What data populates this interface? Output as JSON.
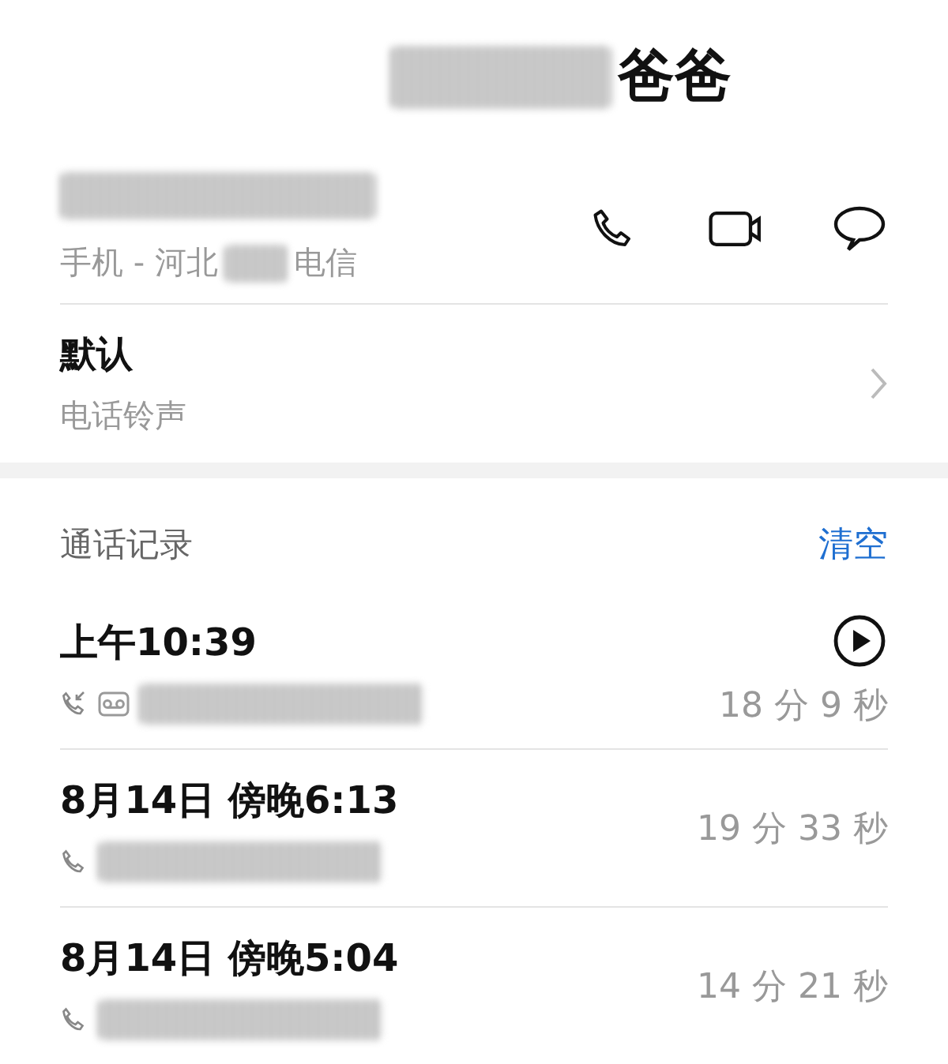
{
  "contact": {
    "name": "爸爸",
    "number_type": "手机 - 河北",
    "carrier": "电信"
  },
  "ringtone": {
    "value": "默认",
    "label": "电话铃声"
  },
  "call_log": {
    "title": "通话记录",
    "clear": "清空",
    "entries": [
      {
        "time": "上午10:39",
        "duration": "18 分 9 秒",
        "voicemail": true
      },
      {
        "time": "8月14日 傍晚6:13",
        "duration": "19 分 33 秒",
        "voicemail": false
      },
      {
        "time": "8月14日 傍晚5:04",
        "duration": "14 分 21 秒",
        "voicemail": false
      }
    ]
  }
}
